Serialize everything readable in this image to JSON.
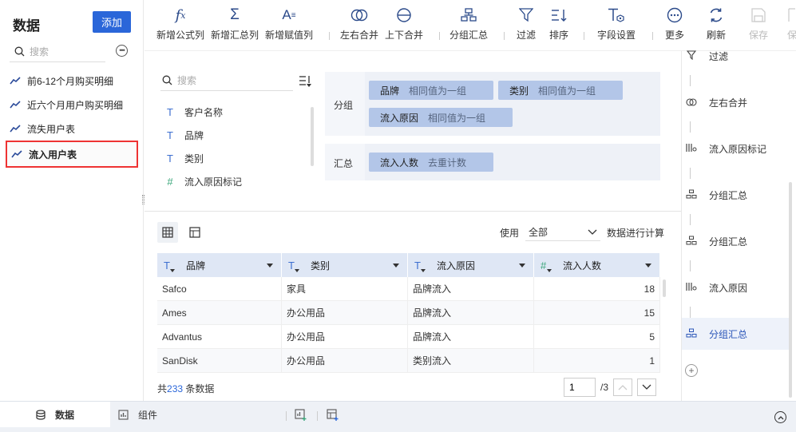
{
  "sidebar": {
    "title": "数据",
    "add_label": "添加",
    "search_placeholder": "搜索",
    "items": [
      {
        "label": "前6-12个月购买明细"
      },
      {
        "label": "近六个月用户购买明细"
      },
      {
        "label": "流失用户表"
      },
      {
        "label": "流入用户表"
      }
    ]
  },
  "toolbar": {
    "buttons": [
      {
        "label": "新增公式列",
        "icon": "fx-icon"
      },
      {
        "label": "新增汇总列",
        "icon": "sigma-icon"
      },
      {
        "label": "新增赋值列",
        "icon": "assign-icon"
      },
      {
        "label": "左右合并",
        "icon": "merge-lr-icon"
      },
      {
        "label": "上下合并",
        "icon": "merge-tb-icon"
      },
      {
        "label": "分组汇总",
        "icon": "group-summary-icon"
      },
      {
        "label": "过滤",
        "icon": "filter-icon"
      },
      {
        "label": "排序",
        "icon": "sort-icon"
      },
      {
        "label": "字段设置",
        "icon": "field-settings-icon"
      },
      {
        "label": "更多",
        "icon": "more-icon"
      },
      {
        "label": "刷新",
        "icon": "refresh-icon"
      },
      {
        "label": "保存",
        "icon": "save-icon"
      },
      {
        "label": "保",
        "icon": "save-icon"
      }
    ]
  },
  "fields": {
    "search_placeholder": "搜索",
    "items": [
      {
        "type": "T",
        "label": "客户名称"
      },
      {
        "type": "T",
        "label": "品牌"
      },
      {
        "type": "T",
        "label": "类别"
      },
      {
        "type": "#",
        "label": "流入原因标记"
      }
    ]
  },
  "group": {
    "label": "分组",
    "chips": [
      {
        "name": "品牌",
        "mode": "相同值为一组"
      },
      {
        "name": "类别",
        "mode": "相同值为一组"
      },
      {
        "name": "流入原因",
        "mode": "相同值为一组"
      }
    ]
  },
  "summary": {
    "label": "汇总",
    "chips": [
      {
        "name": "流入人数",
        "mode": "去重计数"
      }
    ]
  },
  "calc": {
    "prefix": "使用",
    "selected": "全部",
    "suffix": "数据进行计算"
  },
  "table": {
    "columns": [
      {
        "type": "T",
        "label": "品牌"
      },
      {
        "type": "T",
        "label": "类别"
      },
      {
        "type": "T",
        "label": "流入原因"
      },
      {
        "type": "#",
        "label": "流入人数"
      }
    ],
    "rows": [
      [
        "Safco",
        "家具",
        "品牌流入",
        "18"
      ],
      [
        "Ames",
        "办公用品",
        "品牌流入",
        "15"
      ],
      [
        "Advantus",
        "办公用品",
        "品牌流入",
        "5"
      ],
      [
        "SanDisk",
        "办公用品",
        "类别流入",
        "1"
      ]
    ]
  },
  "footer": {
    "total_prefix": "共",
    "total_count": "233",
    "total_suffix": "条数据",
    "page_value": "1",
    "page_total": "/3"
  },
  "steps": [
    {
      "label": "过滤",
      "icon": "filter-icon"
    },
    {
      "label": "左右合并",
      "icon": "merge-lr-icon"
    },
    {
      "label": "流入原因标记",
      "icon": "formula-column-icon"
    },
    {
      "label": "分组汇总",
      "icon": "group-summary-icon"
    },
    {
      "label": "分组汇总",
      "icon": "group-summary-icon"
    },
    {
      "label": "流入原因",
      "icon": "formula-column-icon"
    },
    {
      "label": "分组汇总",
      "icon": "group-summary-icon"
    }
  ],
  "bottom": {
    "tab_data": "数据",
    "tab_component": "组件"
  },
  "colors": {
    "accent": "#2a66d9",
    "chip": "#b3c6e8",
    "highlight_border": "#ee3333"
  }
}
